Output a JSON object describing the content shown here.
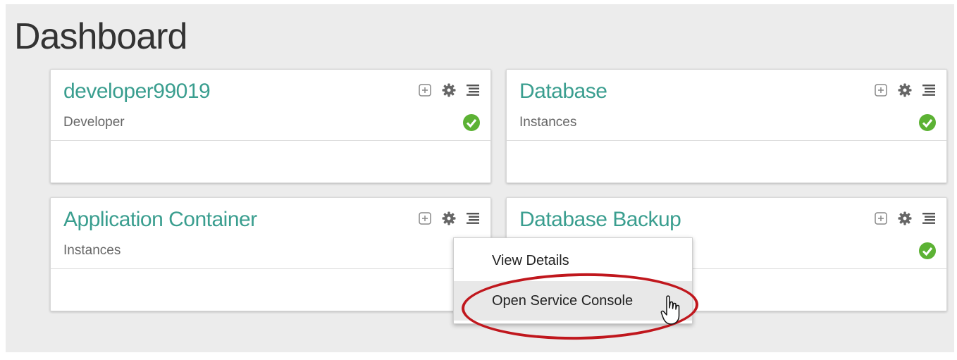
{
  "page": {
    "title": "Dashboard"
  },
  "cards": [
    {
      "name": "developer99019",
      "subtitle": "Developer",
      "status": "ok"
    },
    {
      "name": "Database",
      "subtitle": "Instances",
      "status": "ok"
    },
    {
      "name": "Application Container",
      "subtitle": "Instances",
      "status": "none"
    },
    {
      "name": "Database Backup",
      "subtitle": "",
      "status": "ok"
    }
  ],
  "icons": {
    "add": "plus-box-icon",
    "settings": "gear-icon",
    "menu": "hamburger-menu-icon",
    "status": "check-circle-icon"
  },
  "context_menu": {
    "items": [
      {
        "label": "View Details",
        "highlighted": false
      },
      {
        "label": "Open Service Console",
        "highlighted": true
      }
    ]
  },
  "colors": {
    "accent": "#3a9e8f",
    "status_ok": "#5cb234",
    "highlight_ring": "#c0171d",
    "background": "#ececec"
  }
}
